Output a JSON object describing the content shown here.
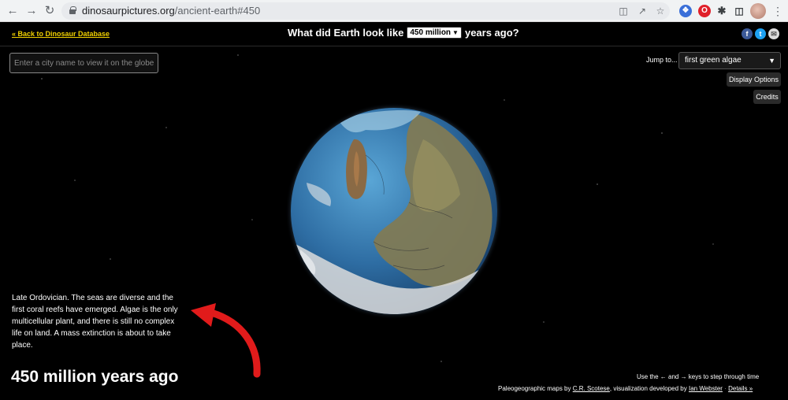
{
  "browser": {
    "url_domain": "dinosaurpictures.org",
    "url_path": "/ancient-earth#450",
    "back_icon": "arrow-left-icon",
    "forward_icon": "arrow-right-icon",
    "reload_icon": "reload-icon"
  },
  "header": {
    "back_link": "« Back to Dinosaur Database",
    "title_prefix": "What did Earth look like",
    "title_select_value": "450 million",
    "title_suffix": "years ago?",
    "social": [
      "f",
      "t",
      "✉"
    ]
  },
  "search": {
    "placeholder": "Enter a city name to view it on the globe"
  },
  "controls": {
    "jump_label": "Jump to...",
    "jump_value": "first green algae",
    "display_options": "Display Options",
    "credits": "Credits"
  },
  "info": {
    "description": "Late Ordovician. The seas are diverse and the first coral reefs have emerged. Algae is the only multicellular plant, and there is still no complex life on land. A mass extinction is about to take place.",
    "years_ago": "450 million years ago"
  },
  "footer": {
    "hint": "Use the ← and → keys to step through time",
    "credit_prefix": "Paleogeographic maps by",
    "credit_scotese": "C.R. Scotese",
    "credit_middle": ", visualization developed by",
    "credit_webster": "Ian Webster",
    "credit_sep": "·",
    "details": "Details »"
  },
  "colors": {
    "link_yellow": "#f0d000",
    "annotation_arrow": "#e11b1b",
    "facebook": "#3b5998",
    "twitter": "#1da1f2"
  }
}
